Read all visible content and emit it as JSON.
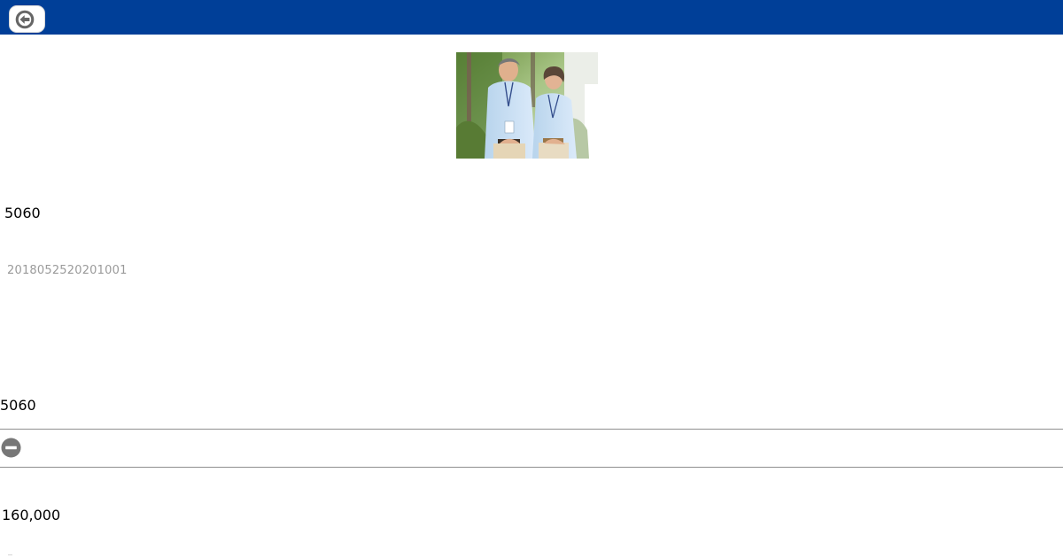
{
  "header": {
    "back_icon": "arrow-left-circle-icon",
    "color": "#003f98"
  },
  "product": {
    "code": "5060",
    "id": "2018052520201001",
    "code_repeat": "5060",
    "price": "160,000",
    "image_description": "photo of two smiling people in light blue uniforms standing outdoors"
  },
  "actions": {
    "remove_icon": "minus-circle-icon"
  }
}
